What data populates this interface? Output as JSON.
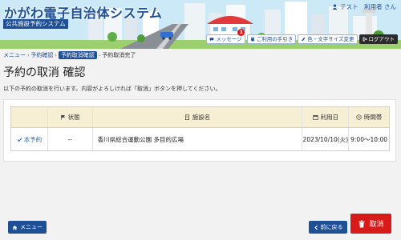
{
  "header": {
    "title": "かがわ電子自治体システム",
    "subtitle": "公共施設予約システム",
    "user_name": "テスト　利用者 さん",
    "buttons": [
      {
        "label": "メッセージ",
        "badge": "1"
      },
      {
        "label": "ご利用の手引き"
      },
      {
        "label": "色・文字サイズ変更"
      },
      {
        "label": "ログアウト"
      }
    ]
  },
  "breadcrumb": {
    "items": [
      "メニュー",
      "予約確認",
      "予約取消確認",
      "予約取消完了"
    ]
  },
  "page": {
    "title": "予約の取消 確認",
    "instruction": "以下の予約の取消を行います。内容がよろしければ「取消」ボタンを押してください。"
  },
  "table": {
    "headers": {
      "status": "状態",
      "facility": "施設名",
      "date": "利用日",
      "time": "時間帯"
    },
    "rows": [
      {
        "type": "本予約",
        "status": "--",
        "facility": "香川県総合運動公園 多目的広場",
        "date": "2023/10/10(火)",
        "time": "9:00～10:00"
      }
    ]
  },
  "footer": {
    "menu_label": "メニュー",
    "back_label": "前に戻る",
    "cancel_label": "取消"
  },
  "colors": {
    "primary": "#1f4f95",
    "danger": "#d71a1a",
    "table_header": "#f6efd4",
    "badge": "#d91b1b"
  },
  "icons": [
    "user-icon",
    "message-icon",
    "guide-book-icon",
    "palette-icon",
    "logout-icon",
    "flag-icon",
    "building-icon",
    "calendar-icon",
    "clock-icon",
    "check-icon",
    "home-icon",
    "chevron-left-icon",
    "trash-icon"
  ]
}
